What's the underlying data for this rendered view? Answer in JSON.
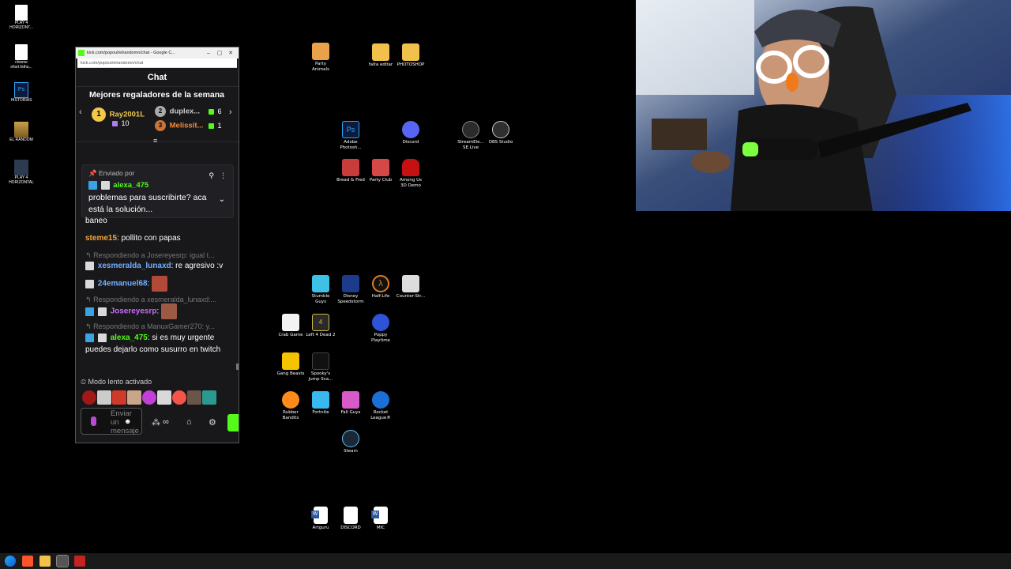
{
  "left_icons": [
    {
      "name": "play4-horizontal-1",
      "label": "PLAY 4\nHORIZONT...",
      "kind": "file"
    },
    {
      "name": "chisme-short",
      "label": "chisme\nshort.fsthu...",
      "kind": "file"
    },
    {
      "name": "historias",
      "label": "HISTORIAS",
      "kind": "ps"
    },
    {
      "name": "el-random",
      "label": "EL RANDOM",
      "kind": "winrar"
    },
    {
      "name": "play4-horizontal-2",
      "label": "PLAY 4\nHORIZONTAL",
      "kind": "video"
    }
  ],
  "chat_window": {
    "title": "kick.com/popout/elrandomn/chat - Google C...",
    "url": "kick.com/popout/elrandomn/chat",
    "header": "Chat",
    "gifters_title": "Mejores regaladores de la semana",
    "gifters": [
      {
        "rank": "1",
        "name": "Ray2001L",
        "count": "10"
      },
      {
        "rank": "2",
        "name": "duplex...",
        "count": "6"
      },
      {
        "rank": "3",
        "name": "Melissit...",
        "count": "1"
      }
    ],
    "pinned": {
      "label": "Enviado por",
      "user": "alexa_475",
      "text": "problemas para suscribirte? aca está la solución..."
    },
    "messages": [
      {
        "user": "",
        "text": "baneo"
      },
      {
        "user": "steme15",
        "text": ": pollito con papas"
      },
      {
        "reply": "Respondiendo a Josereyesrp: igual t..."
      },
      {
        "user": "xesmeralda_lunaxd",
        "text": ": re agresivo :v"
      },
      {
        "user": "24emanuel68",
        "text": ":"
      },
      {
        "reply": "Respondiendo a xesmeralda_lunaxd:..."
      },
      {
        "user": "Josereyesrp",
        "text": ":"
      },
      {
        "reply": "Respondiendo a ManuxGamer270: y..."
      },
      {
        "user": "alexa_475",
        "text": ": si es muy urgente puedes dejarlo como susurro en twitch"
      }
    ],
    "slow_mode": "Modo lento activado",
    "input_placeholder": "Enviar un mensaje"
  },
  "desktop_icons": [
    {
      "label": "Party\nAnimals",
      "color": "#e8a34a"
    },
    {
      "label": "falta editar",
      "color": "#f1c14b"
    },
    {
      "label": "PHOTOSHOP",
      "color": "#f1c14b"
    },
    {
      "label": "Adobe\nPhotosh...",
      "color": "#0a1b3d"
    },
    {
      "label": "Discord",
      "color": "#5865f2"
    },
    {
      "label": "StreamEle...\nSE.Live",
      "color": "#2b2b2b"
    },
    {
      "label": "OBS Studio",
      "color": "#302e31"
    },
    {
      "label": "Bread & Fred",
      "color": "#c93c3c"
    },
    {
      "label": "Party Club",
      "color": "#d44848"
    },
    {
      "label": "Among Us\n3D Demo",
      "color": "#c51111"
    },
    {
      "label": "Stumble\nGuys",
      "color": "#3ec1e6"
    },
    {
      "label": "Disney\nSpeedstorm",
      "color": "#1c3b8a"
    },
    {
      "label": "Half-Life",
      "color": "#e07b1f"
    },
    {
      "label": "Counter-Str...",
      "color": "#3a3a3a"
    },
    {
      "label": "Crab Game",
      "color": "#f3f3f3"
    },
    {
      "label": "Left 4 Dead 2",
      "color": "#2a2a2a"
    },
    {
      "label": "Poppy\nPlaytime",
      "color": "#2d53d6"
    },
    {
      "label": "Gang Beasts",
      "color": "#f5c400"
    },
    {
      "label": "Spooky's\nJump Sca...",
      "color": "#111"
    },
    {
      "label": "Rubber\nBandits",
      "color": "#ff8b1a"
    },
    {
      "label": "Fortnite",
      "color": "#39b8f0"
    },
    {
      "label": "Fall Guys",
      "color": "#d85ac9"
    },
    {
      "label": "Rocket\nLeague®",
      "color": "#1c6fd4"
    },
    {
      "label": "Steam",
      "color": "#1b2838"
    },
    {
      "label": "Artguru",
      "color": "#2b579a"
    },
    {
      "label": "DISCORD",
      "color": "#ffffff"
    },
    {
      "label": "MIC",
      "color": "#2b579a"
    }
  ],
  "taskbar": [
    "windows-icon",
    "brave-icon",
    "explorer-icon",
    "chrome-icon",
    "streamlabs-icon"
  ]
}
